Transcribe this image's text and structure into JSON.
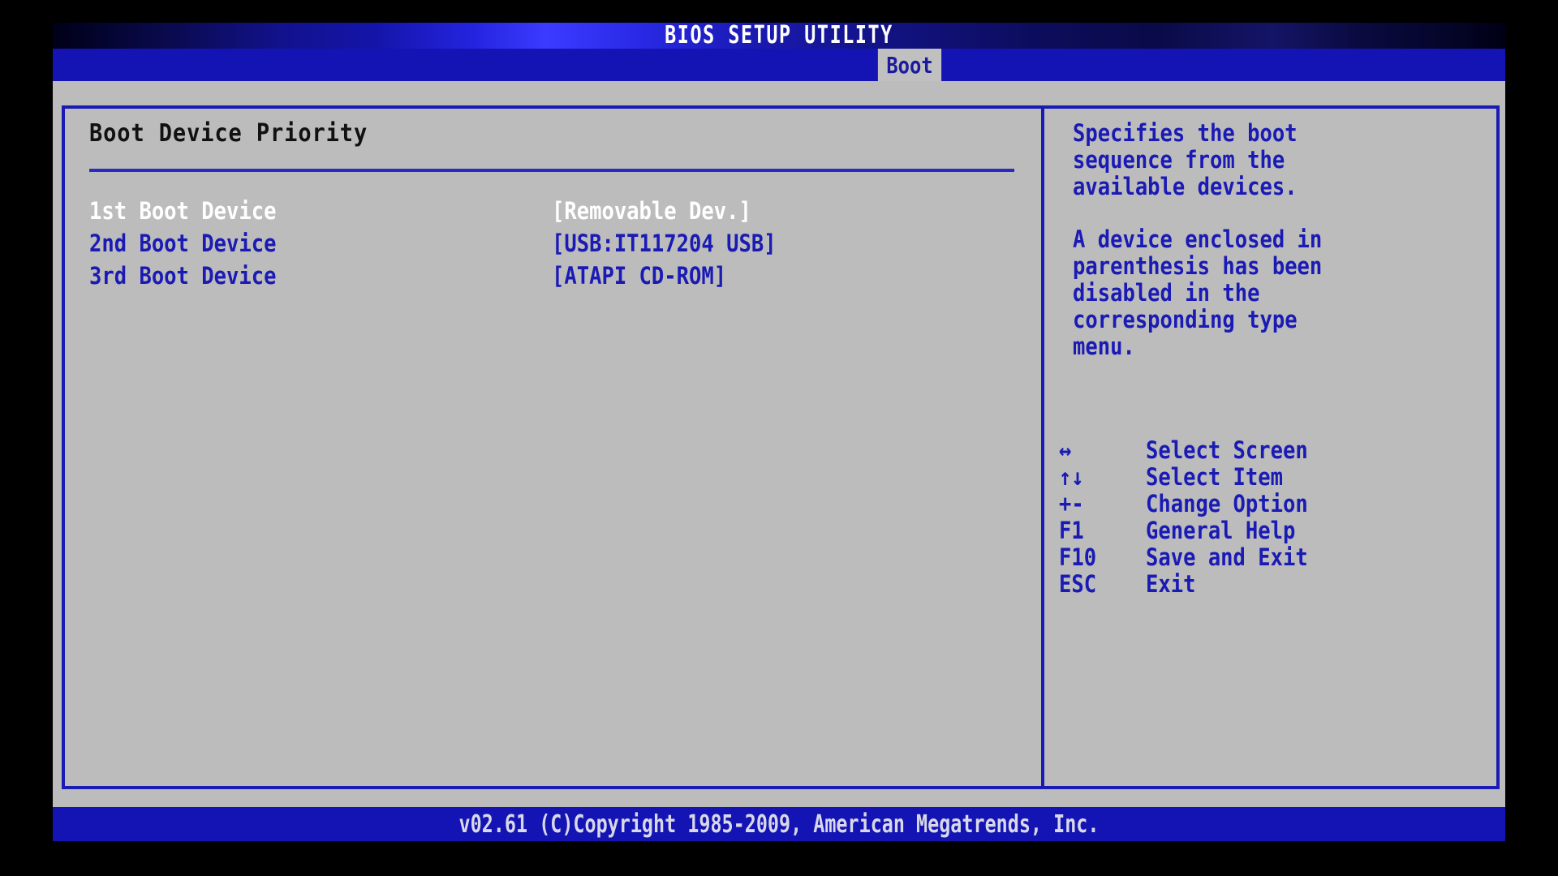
{
  "window": {
    "title": "BIOS SETUP UTILITY"
  },
  "nav": {
    "active_tab": "Boot",
    "tabs": [
      "Boot"
    ]
  },
  "main": {
    "section_title": "Boot Device Priority",
    "settings": [
      {
        "label": "1st Boot Device",
        "value": "[Removable Dev.]",
        "selected": true
      },
      {
        "label": "2nd Boot Device",
        "value": "[USB:IT117204 USB]",
        "selected": false
      },
      {
        "label": "3rd Boot Device",
        "value": "[ATAPI CD-ROM]",
        "selected": false
      }
    ]
  },
  "help": {
    "paragraphs": [
      [
        "Specifies the boot",
        "sequence from the",
        "available devices."
      ],
      [
        "A device enclosed in",
        "parenthesis has been",
        "disabled in the",
        "corresponding type",
        "menu."
      ]
    ]
  },
  "legend": [
    {
      "key": "↔",
      "desc": "Select Screen"
    },
    {
      "key": "↑↓",
      "desc": "Select Item"
    },
    {
      "key": "+-",
      "desc": "Change Option"
    },
    {
      "key": "F1",
      "desc": "General Help"
    },
    {
      "key": "F10",
      "desc": "Save and Exit"
    },
    {
      "key": "ESC",
      "desc": "Exit"
    }
  ],
  "footer": {
    "text": "v02.61 (C)Copyright 1985-2009, American Megatrends, Inc."
  },
  "colors": {
    "accent_blue": "#1a1ab4",
    "panel_gray": "#bcbcbc",
    "tab_gray": "#c0c0c0",
    "selected_text": "#ffffff",
    "title_text": "#ffffff"
  }
}
